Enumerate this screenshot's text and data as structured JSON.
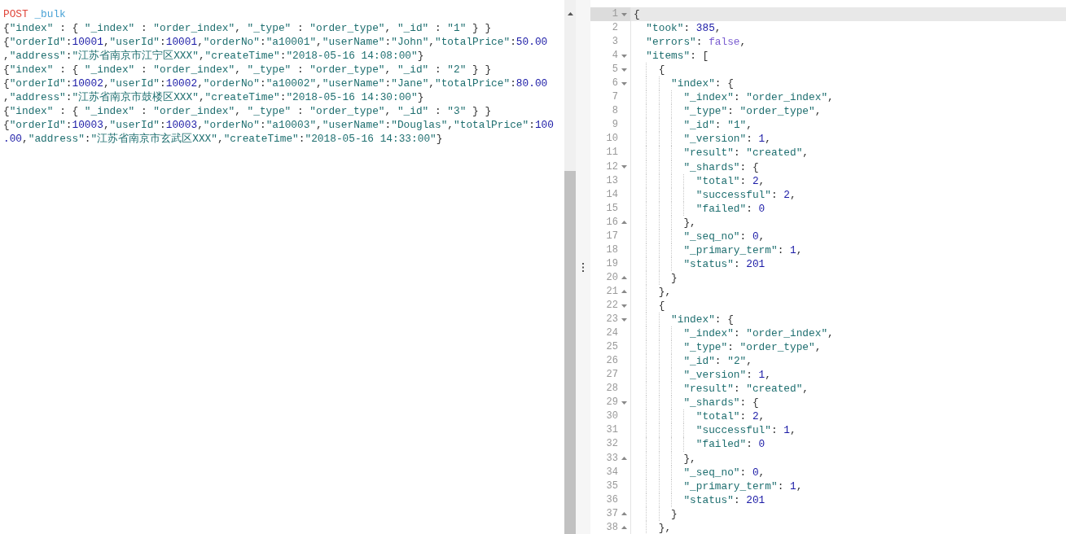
{
  "request_editor": {
    "lines": [
      {
        "tokens": [
          {
            "kind": "method",
            "text": "POST"
          },
          {
            "kind": "path",
            "text": " _bulk"
          }
        ]
      },
      {
        "tokens": [
          {
            "kind": "punct",
            "text": "{"
          },
          {
            "kind": "str",
            "text": "\"index\""
          },
          {
            "kind": "punct",
            "text": " : { "
          },
          {
            "kind": "str",
            "text": "\"_index\""
          },
          {
            "kind": "punct",
            "text": " : "
          },
          {
            "kind": "str",
            "text": "\"order_index\""
          },
          {
            "kind": "punct",
            "text": ", "
          },
          {
            "kind": "str",
            "text": "\"_type\""
          },
          {
            "kind": "punct",
            "text": " : "
          },
          {
            "kind": "str",
            "text": "\"order_type\""
          },
          {
            "kind": "punct",
            "text": ", "
          },
          {
            "kind": "str",
            "text": "\"_id\""
          },
          {
            "kind": "punct",
            "text": " : "
          },
          {
            "kind": "str",
            "text": "\"1\""
          },
          {
            "kind": "punct",
            "text": " } }"
          }
        ]
      },
      {
        "tokens": [
          {
            "kind": "punct",
            "text": "{"
          },
          {
            "kind": "str",
            "text": "\"orderId\""
          },
          {
            "kind": "punct",
            "text": ":"
          },
          {
            "kind": "num",
            "text": "10001"
          },
          {
            "kind": "punct",
            "text": ","
          },
          {
            "kind": "str",
            "text": "\"userId\""
          },
          {
            "kind": "punct",
            "text": ":"
          },
          {
            "kind": "num",
            "text": "10001"
          },
          {
            "kind": "punct",
            "text": ","
          },
          {
            "kind": "str",
            "text": "\"orderNo\""
          },
          {
            "kind": "punct",
            "text": ":"
          },
          {
            "kind": "str",
            "text": "\"a10001\""
          },
          {
            "kind": "punct",
            "text": ","
          },
          {
            "kind": "str",
            "text": "\"userName\""
          },
          {
            "kind": "punct",
            "text": ":"
          },
          {
            "kind": "str",
            "text": "\"John\""
          },
          {
            "kind": "punct",
            "text": ","
          },
          {
            "kind": "str",
            "text": "\"totalPrice\""
          },
          {
            "kind": "punct",
            "text": ":"
          },
          {
            "kind": "num",
            "text": "50.00"
          }
        ]
      },
      {
        "tokens": [
          {
            "kind": "punct",
            "text": ","
          },
          {
            "kind": "str",
            "text": "\"address\""
          },
          {
            "kind": "punct",
            "text": ":"
          },
          {
            "kind": "str",
            "text": "\"江苏省南京市江宁区XXX\""
          },
          {
            "kind": "punct",
            "text": ","
          },
          {
            "kind": "str",
            "text": "\"createTime\""
          },
          {
            "kind": "punct",
            "text": ":"
          },
          {
            "kind": "str",
            "text": "\"2018-05-16 14:08:00\""
          },
          {
            "kind": "punct",
            "text": "}"
          }
        ]
      },
      {
        "tokens": [
          {
            "kind": "punct",
            "text": "{"
          },
          {
            "kind": "str",
            "text": "\"index\""
          },
          {
            "kind": "punct",
            "text": " : { "
          },
          {
            "kind": "str",
            "text": "\"_index\""
          },
          {
            "kind": "punct",
            "text": " : "
          },
          {
            "kind": "str",
            "text": "\"order_index\""
          },
          {
            "kind": "punct",
            "text": ", "
          },
          {
            "kind": "str",
            "text": "\"_type\""
          },
          {
            "kind": "punct",
            "text": " : "
          },
          {
            "kind": "str",
            "text": "\"order_type\""
          },
          {
            "kind": "punct",
            "text": ", "
          },
          {
            "kind": "str",
            "text": "\"_id\""
          },
          {
            "kind": "punct",
            "text": " : "
          },
          {
            "kind": "str",
            "text": "\"2\""
          },
          {
            "kind": "punct",
            "text": " } }"
          }
        ]
      },
      {
        "tokens": [
          {
            "kind": "punct",
            "text": "{"
          },
          {
            "kind": "str",
            "text": "\"orderId\""
          },
          {
            "kind": "punct",
            "text": ":"
          },
          {
            "kind": "num",
            "text": "10002"
          },
          {
            "kind": "punct",
            "text": ","
          },
          {
            "kind": "str",
            "text": "\"userId\""
          },
          {
            "kind": "punct",
            "text": ":"
          },
          {
            "kind": "num",
            "text": "10002"
          },
          {
            "kind": "punct",
            "text": ","
          },
          {
            "kind": "str",
            "text": "\"orderNo\""
          },
          {
            "kind": "punct",
            "text": ":"
          },
          {
            "kind": "str",
            "text": "\"a10002\""
          },
          {
            "kind": "punct",
            "text": ","
          },
          {
            "kind": "str",
            "text": "\"userName\""
          },
          {
            "kind": "punct",
            "text": ":"
          },
          {
            "kind": "str",
            "text": "\"Jane\""
          },
          {
            "kind": "punct",
            "text": ","
          },
          {
            "kind": "str",
            "text": "\"totalPrice\""
          },
          {
            "kind": "punct",
            "text": ":"
          },
          {
            "kind": "num",
            "text": "80.00"
          }
        ]
      },
      {
        "tokens": [
          {
            "kind": "punct",
            "text": ","
          },
          {
            "kind": "str",
            "text": "\"address\""
          },
          {
            "kind": "punct",
            "text": ":"
          },
          {
            "kind": "str",
            "text": "\"江苏省南京市鼓楼区XXX\""
          },
          {
            "kind": "punct",
            "text": ","
          },
          {
            "kind": "str",
            "text": "\"createTime\""
          },
          {
            "kind": "punct",
            "text": ":"
          },
          {
            "kind": "str",
            "text": "\"2018-05-16 14:30:00\""
          },
          {
            "kind": "punct",
            "text": "}"
          }
        ]
      },
      {
        "tokens": [
          {
            "kind": "punct",
            "text": "{"
          },
          {
            "kind": "str",
            "text": "\"index\""
          },
          {
            "kind": "punct",
            "text": " : { "
          },
          {
            "kind": "str",
            "text": "\"_index\""
          },
          {
            "kind": "punct",
            "text": " : "
          },
          {
            "kind": "str",
            "text": "\"order_index\""
          },
          {
            "kind": "punct",
            "text": ", "
          },
          {
            "kind": "str",
            "text": "\"_type\""
          },
          {
            "kind": "punct",
            "text": " : "
          },
          {
            "kind": "str",
            "text": "\"order_type\""
          },
          {
            "kind": "punct",
            "text": ", "
          },
          {
            "kind": "str",
            "text": "\"_id\""
          },
          {
            "kind": "punct",
            "text": " : "
          },
          {
            "kind": "str",
            "text": "\"3\""
          },
          {
            "kind": "punct",
            "text": " } }"
          }
        ]
      },
      {
        "tokens": [
          {
            "kind": "punct",
            "text": "{"
          },
          {
            "kind": "str",
            "text": "\"orderId\""
          },
          {
            "kind": "punct",
            "text": ":"
          },
          {
            "kind": "num",
            "text": "10003"
          },
          {
            "kind": "punct",
            "text": ","
          },
          {
            "kind": "str",
            "text": "\"userId\""
          },
          {
            "kind": "punct",
            "text": ":"
          },
          {
            "kind": "num",
            "text": "10003"
          },
          {
            "kind": "punct",
            "text": ","
          },
          {
            "kind": "str",
            "text": "\"orderNo\""
          },
          {
            "kind": "punct",
            "text": ":"
          },
          {
            "kind": "str",
            "text": "\"a10003\""
          },
          {
            "kind": "punct",
            "text": ","
          },
          {
            "kind": "str",
            "text": "\"userName\""
          },
          {
            "kind": "punct",
            "text": ":"
          },
          {
            "kind": "str",
            "text": "\"Douglas\""
          },
          {
            "kind": "punct",
            "text": ","
          },
          {
            "kind": "str",
            "text": "\"totalPrice\""
          },
          {
            "kind": "punct",
            "text": ":"
          },
          {
            "kind": "num",
            "text": "100"
          }
        ]
      },
      {
        "tokens": [
          {
            "kind": "num",
            "text": ".00"
          },
          {
            "kind": "punct",
            "text": ","
          },
          {
            "kind": "str",
            "text": "\"address\""
          },
          {
            "kind": "punct",
            "text": ":"
          },
          {
            "kind": "str",
            "text": "\"江苏省南京市玄武区XXX\""
          },
          {
            "kind": "punct",
            "text": ","
          },
          {
            "kind": "str",
            "text": "\"createTime\""
          },
          {
            "kind": "punct",
            "text": ":"
          },
          {
            "kind": "str",
            "text": "\"2018-05-16 14:33:00\""
          },
          {
            "kind": "punct",
            "text": "}"
          }
        ]
      }
    ]
  },
  "response_editor": {
    "lines": [
      {
        "number": "1",
        "kind": "opener",
        "selected": true,
        "tokens": [
          {
            "kind": "punct",
            "text": "{"
          }
        ]
      },
      {
        "number": "2",
        "kind": "plain",
        "selected": false,
        "tokens": [
          {
            "kind": "str",
            "text": "  \"took\""
          },
          {
            "kind": "punct",
            "text": ": "
          },
          {
            "kind": "num",
            "text": "385"
          },
          {
            "kind": "punct",
            "text": ","
          }
        ]
      },
      {
        "number": "3",
        "kind": "plain",
        "selected": false,
        "tokens": [
          {
            "kind": "str",
            "text": "  \"errors\""
          },
          {
            "kind": "punct",
            "text": ": "
          },
          {
            "kind": "bool",
            "text": "false"
          },
          {
            "kind": "punct",
            "text": ","
          }
        ]
      },
      {
        "number": "4",
        "kind": "opener",
        "selected": false,
        "tokens": [
          {
            "kind": "str",
            "text": "  \"items\""
          },
          {
            "kind": "punct",
            "text": ": ["
          }
        ]
      },
      {
        "number": "5",
        "kind": "opener",
        "selected": false,
        "tokens": [
          {
            "kind": "punct",
            "text": "    {"
          }
        ]
      },
      {
        "number": "6",
        "kind": "opener",
        "selected": false,
        "tokens": [
          {
            "kind": "str",
            "text": "      \"index\""
          },
          {
            "kind": "punct",
            "text": ": {"
          }
        ]
      },
      {
        "number": "7",
        "kind": "plain",
        "selected": false,
        "tokens": [
          {
            "kind": "str",
            "text": "        \"_index\""
          },
          {
            "kind": "punct",
            "text": ": "
          },
          {
            "kind": "str",
            "text": "\"order_index\""
          },
          {
            "kind": "punct",
            "text": ","
          }
        ]
      },
      {
        "number": "8",
        "kind": "plain",
        "selected": false,
        "tokens": [
          {
            "kind": "str",
            "text": "        \"_type\""
          },
          {
            "kind": "punct",
            "text": ": "
          },
          {
            "kind": "str",
            "text": "\"order_type\""
          },
          {
            "kind": "punct",
            "text": ","
          }
        ]
      },
      {
        "number": "9",
        "kind": "plain",
        "selected": false,
        "tokens": [
          {
            "kind": "str",
            "text": "        \"_id\""
          },
          {
            "kind": "punct",
            "text": ": "
          },
          {
            "kind": "str",
            "text": "\"1\""
          },
          {
            "kind": "punct",
            "text": ","
          }
        ]
      },
      {
        "number": "10",
        "kind": "plain",
        "selected": false,
        "tokens": [
          {
            "kind": "str",
            "text": "        \"_version\""
          },
          {
            "kind": "punct",
            "text": ": "
          },
          {
            "kind": "num",
            "text": "1"
          },
          {
            "kind": "punct",
            "text": ","
          }
        ]
      },
      {
        "number": "11",
        "kind": "plain",
        "selected": false,
        "tokens": [
          {
            "kind": "str",
            "text": "        \"result\""
          },
          {
            "kind": "punct",
            "text": ": "
          },
          {
            "kind": "str",
            "text": "\"created\""
          },
          {
            "kind": "punct",
            "text": ","
          }
        ]
      },
      {
        "number": "12",
        "kind": "opener",
        "selected": false,
        "tokens": [
          {
            "kind": "str",
            "text": "        \"_shards\""
          },
          {
            "kind": "punct",
            "text": ": {"
          }
        ]
      },
      {
        "number": "13",
        "kind": "plain",
        "selected": false,
        "tokens": [
          {
            "kind": "str",
            "text": "          \"total\""
          },
          {
            "kind": "punct",
            "text": ": "
          },
          {
            "kind": "num",
            "text": "2"
          },
          {
            "kind": "punct",
            "text": ","
          }
        ]
      },
      {
        "number": "14",
        "kind": "plain",
        "selected": false,
        "tokens": [
          {
            "kind": "str",
            "text": "          \"successful\""
          },
          {
            "kind": "punct",
            "text": ": "
          },
          {
            "kind": "num",
            "text": "2"
          },
          {
            "kind": "punct",
            "text": ","
          }
        ]
      },
      {
        "number": "15",
        "kind": "plain",
        "selected": false,
        "tokens": [
          {
            "kind": "str",
            "text": "          \"failed\""
          },
          {
            "kind": "punct",
            "text": ": "
          },
          {
            "kind": "num",
            "text": "0"
          }
        ]
      },
      {
        "number": "16",
        "kind": "closer",
        "selected": false,
        "tokens": [
          {
            "kind": "punct",
            "text": "        },"
          }
        ]
      },
      {
        "number": "17",
        "kind": "plain",
        "selected": false,
        "tokens": [
          {
            "kind": "str",
            "text": "        \"_seq_no\""
          },
          {
            "kind": "punct",
            "text": ": "
          },
          {
            "kind": "num",
            "text": "0"
          },
          {
            "kind": "punct",
            "text": ","
          }
        ]
      },
      {
        "number": "18",
        "kind": "plain",
        "selected": false,
        "tokens": [
          {
            "kind": "str",
            "text": "        \"_primary_term\""
          },
          {
            "kind": "punct",
            "text": ": "
          },
          {
            "kind": "num",
            "text": "1"
          },
          {
            "kind": "punct",
            "text": ","
          }
        ]
      },
      {
        "number": "19",
        "kind": "plain",
        "selected": false,
        "tokens": [
          {
            "kind": "str",
            "text": "        \"status\""
          },
          {
            "kind": "punct",
            "text": ": "
          },
          {
            "kind": "num",
            "text": "201"
          }
        ]
      },
      {
        "number": "20",
        "kind": "closer",
        "selected": false,
        "tokens": [
          {
            "kind": "punct",
            "text": "      }"
          }
        ]
      },
      {
        "number": "21",
        "kind": "closer",
        "selected": false,
        "tokens": [
          {
            "kind": "punct",
            "text": "    },"
          }
        ]
      },
      {
        "number": "22",
        "kind": "opener",
        "selected": false,
        "tokens": [
          {
            "kind": "punct",
            "text": "    {"
          }
        ]
      },
      {
        "number": "23",
        "kind": "opener",
        "selected": false,
        "tokens": [
          {
            "kind": "str",
            "text": "      \"index\""
          },
          {
            "kind": "punct",
            "text": ": {"
          }
        ]
      },
      {
        "number": "24",
        "kind": "plain",
        "selected": false,
        "tokens": [
          {
            "kind": "str",
            "text": "        \"_index\""
          },
          {
            "kind": "punct",
            "text": ": "
          },
          {
            "kind": "str",
            "text": "\"order_index\""
          },
          {
            "kind": "punct",
            "text": ","
          }
        ]
      },
      {
        "number": "25",
        "kind": "plain",
        "selected": false,
        "tokens": [
          {
            "kind": "str",
            "text": "        \"_type\""
          },
          {
            "kind": "punct",
            "text": ": "
          },
          {
            "kind": "str",
            "text": "\"order_type\""
          },
          {
            "kind": "punct",
            "text": ","
          }
        ]
      },
      {
        "number": "26",
        "kind": "plain",
        "selected": false,
        "tokens": [
          {
            "kind": "str",
            "text": "        \"_id\""
          },
          {
            "kind": "punct",
            "text": ": "
          },
          {
            "kind": "str",
            "text": "\"2\""
          },
          {
            "kind": "punct",
            "text": ","
          }
        ]
      },
      {
        "number": "27",
        "kind": "plain",
        "selected": false,
        "tokens": [
          {
            "kind": "str",
            "text": "        \"_version\""
          },
          {
            "kind": "punct",
            "text": ": "
          },
          {
            "kind": "num",
            "text": "1"
          },
          {
            "kind": "punct",
            "text": ","
          }
        ]
      },
      {
        "number": "28",
        "kind": "plain",
        "selected": false,
        "tokens": [
          {
            "kind": "str",
            "text": "        \"result\""
          },
          {
            "kind": "punct",
            "text": ": "
          },
          {
            "kind": "str",
            "text": "\"created\""
          },
          {
            "kind": "punct",
            "text": ","
          }
        ]
      },
      {
        "number": "29",
        "kind": "opener",
        "selected": false,
        "tokens": [
          {
            "kind": "str",
            "text": "        \"_shards\""
          },
          {
            "kind": "punct",
            "text": ": {"
          }
        ]
      },
      {
        "number": "30",
        "kind": "plain",
        "selected": false,
        "tokens": [
          {
            "kind": "str",
            "text": "          \"total\""
          },
          {
            "kind": "punct",
            "text": ": "
          },
          {
            "kind": "num",
            "text": "2"
          },
          {
            "kind": "punct",
            "text": ","
          }
        ]
      },
      {
        "number": "31",
        "kind": "plain",
        "selected": false,
        "tokens": [
          {
            "kind": "str",
            "text": "          \"successful\""
          },
          {
            "kind": "punct",
            "text": ": "
          },
          {
            "kind": "num",
            "text": "1"
          },
          {
            "kind": "punct",
            "text": ","
          }
        ]
      },
      {
        "number": "32",
        "kind": "plain",
        "selected": false,
        "tokens": [
          {
            "kind": "str",
            "text": "          \"failed\""
          },
          {
            "kind": "punct",
            "text": ": "
          },
          {
            "kind": "num",
            "text": "0"
          }
        ]
      },
      {
        "number": "33",
        "kind": "closer",
        "selected": false,
        "tokens": [
          {
            "kind": "punct",
            "text": "        },"
          }
        ]
      },
      {
        "number": "34",
        "kind": "plain",
        "selected": false,
        "tokens": [
          {
            "kind": "str",
            "text": "        \"_seq_no\""
          },
          {
            "kind": "punct",
            "text": ": "
          },
          {
            "kind": "num",
            "text": "0"
          },
          {
            "kind": "punct",
            "text": ","
          }
        ]
      },
      {
        "number": "35",
        "kind": "plain",
        "selected": false,
        "tokens": [
          {
            "kind": "str",
            "text": "        \"_primary_term\""
          },
          {
            "kind": "punct",
            "text": ": "
          },
          {
            "kind": "num",
            "text": "1"
          },
          {
            "kind": "punct",
            "text": ","
          }
        ]
      },
      {
        "number": "36",
        "kind": "plain",
        "selected": false,
        "tokens": [
          {
            "kind": "str",
            "text": "        \"status\""
          },
          {
            "kind": "punct",
            "text": ": "
          },
          {
            "kind": "num",
            "text": "201"
          }
        ]
      },
      {
        "number": "37",
        "kind": "closer",
        "selected": false,
        "tokens": [
          {
            "kind": "punct",
            "text": "      }"
          }
        ]
      },
      {
        "number": "38",
        "kind": "closer",
        "selected": false,
        "tokens": [
          {
            "kind": "punct",
            "text": "    },"
          }
        ]
      }
    ]
  }
}
